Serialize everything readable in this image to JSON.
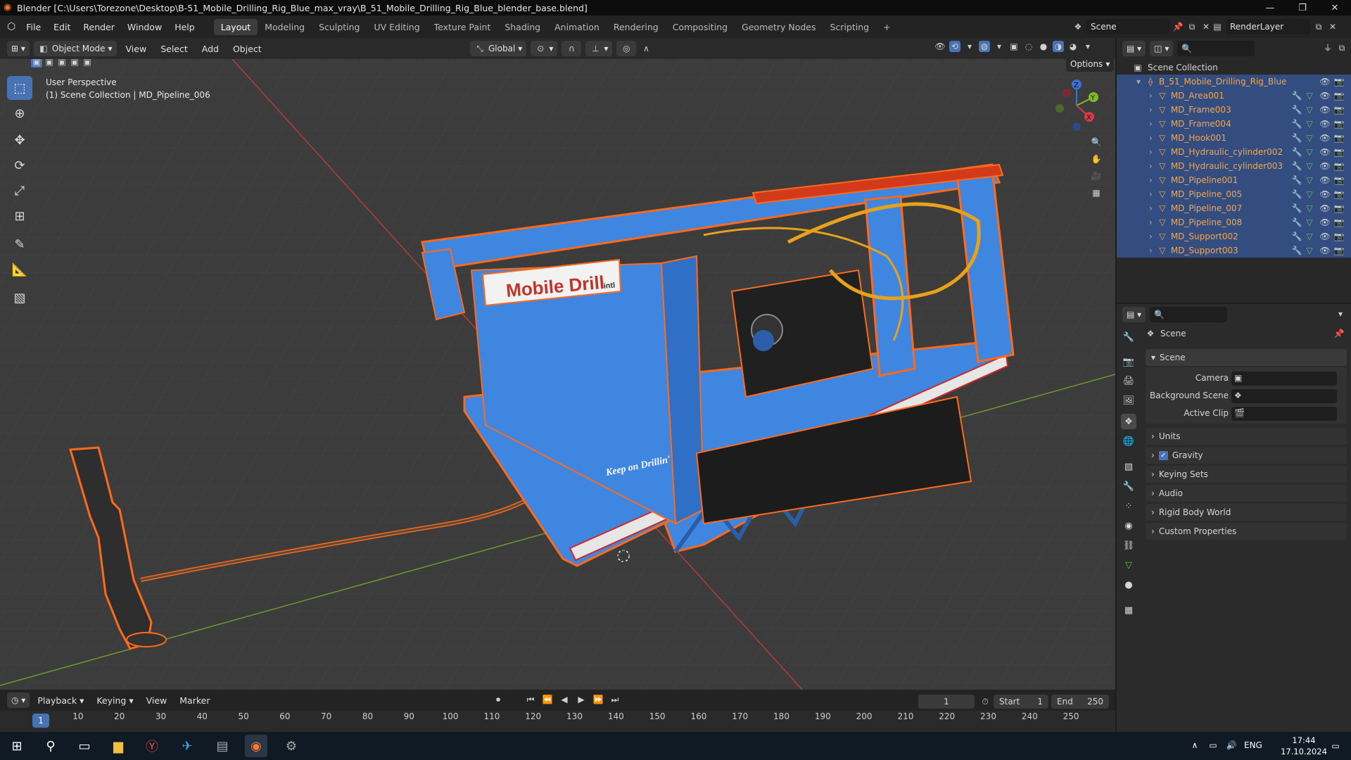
{
  "window": {
    "title": "Blender [C:\\Users\\Torezone\\Desktop\\B-51_Mobile_Drilling_Rig_Blue_max_vray\\B_51_Mobile_Drilling_Rig_Blue_blender_base.blend]",
    "minimize_icon": "minimize-icon",
    "maximize_icon": "maximize-icon",
    "close_icon": "close-icon"
  },
  "menubar": {
    "items": [
      "File",
      "Edit",
      "Render",
      "Window",
      "Help"
    ],
    "workspaces": [
      "Layout",
      "Modeling",
      "Sculpting",
      "UV Editing",
      "Texture Paint",
      "Shading",
      "Animation",
      "Rendering",
      "Compositing",
      "Geometry Nodes",
      "Scripting"
    ],
    "active_workspace": "Layout",
    "add_workspace": "+",
    "scene_name": "Scene",
    "view_layer": "RenderLayer"
  },
  "viewport_header": {
    "mode": "Object Mode",
    "menus": [
      "View",
      "Select",
      "Add",
      "Object"
    ],
    "orientation": "Global",
    "options_label": "Options"
  },
  "viewport": {
    "perspective_label": "User Perspective",
    "context_label": "(1) Scene Collection | MD_Pipeline_006",
    "sign_text": "Mobile Drill",
    "sign_suffix": "intl",
    "decal_text": "Keep on Drillin'",
    "gizmo_axes": [
      "X",
      "Y",
      "Z"
    ]
  },
  "outliner": {
    "root": "Scene Collection",
    "collection": "B_51_Mobile_Drilling_Rig_Blue",
    "objects": [
      "MD_Area001",
      "MD_Frame003",
      "MD_Frame004",
      "MD_Hook001",
      "MD_Hydraulic_cylinder002",
      "MD_Hydraulic_cylinder003",
      "MD_Pipeline001",
      "MD_Pipeline_005",
      "MD_Pipeline_007",
      "MD_Pipeline_008",
      "MD_Support002",
      "MD_Support003"
    ]
  },
  "properties": {
    "context": "Scene",
    "panel_title": "Scene",
    "fields": [
      {
        "label": "Camera",
        "value": ""
      },
      {
        "label": "Background Scene",
        "value": ""
      },
      {
        "label": "Active Clip",
        "value": ""
      }
    ],
    "collapsed_panels": [
      "Units",
      "Gravity",
      "Keying Sets",
      "Audio",
      "Rigid Body World",
      "Custom Properties"
    ],
    "gravity_checked": true
  },
  "timeline": {
    "menus": [
      "Playback",
      "Keying",
      "View",
      "Marker"
    ],
    "current_frame": "1",
    "start_label": "Start",
    "start_value": "1",
    "end_label": "End",
    "end_value": "250",
    "ruler_current": "1",
    "ruler_ticks": [
      "10",
      "20",
      "30",
      "40",
      "50",
      "60",
      "70",
      "80",
      "90",
      "100",
      "110",
      "120",
      "130",
      "140",
      "150",
      "160",
      "170",
      "180",
      "190",
      "200",
      "210",
      "220",
      "230",
      "240",
      "250"
    ]
  },
  "taskbar": {
    "language": "ENG",
    "time": "17:44",
    "date": "17.10.2024"
  },
  "colors": {
    "accent": "#4772b3",
    "selection_outline": "#ff6a1a",
    "rig_blue": "#3f86e0",
    "grid_x_axis": "#b83a3a",
    "grid_y_axis": "#6c9a2e"
  }
}
